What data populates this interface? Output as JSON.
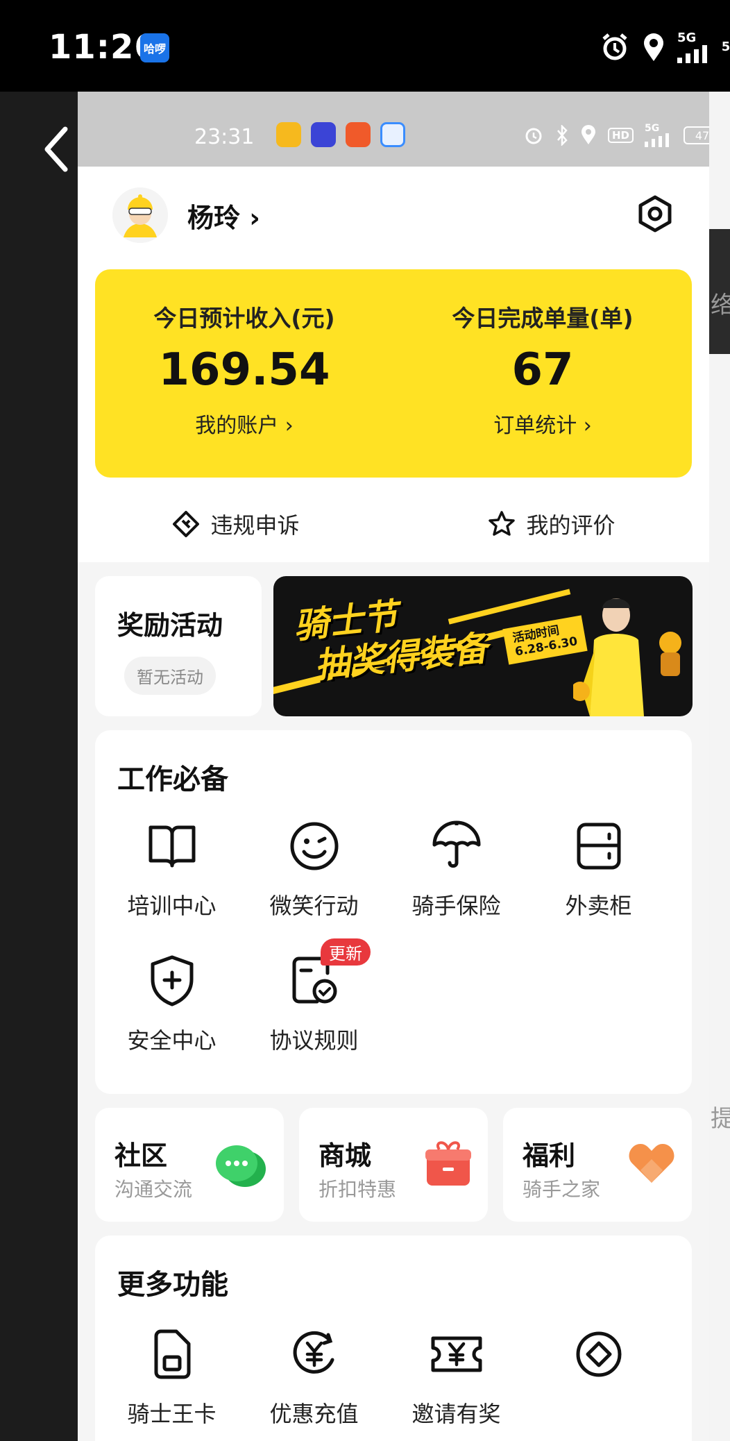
{
  "outer_status": {
    "time": "11:26",
    "app_badge": "哈啰",
    "network": "5G",
    "battery_partial": "5"
  },
  "inner_status": {
    "time": "23:31",
    "network": "5G",
    "hd": "HD",
    "battery": "47"
  },
  "profile": {
    "name": "杨玲 ›"
  },
  "earnings": {
    "income_label": "今日预计收入(元)",
    "income_value": "169.54",
    "account_link": "我的账户 ›",
    "orders_label": "今日完成单量(单)",
    "orders_value": "67",
    "orders_link": "订单统计 ›"
  },
  "quick": {
    "appeal": "违规申诉",
    "review": "我的评价"
  },
  "rewards": {
    "title": "奖励活动",
    "status": "暂无活动"
  },
  "banner": {
    "title_line1": "骑士节",
    "title_line2": "抽奖得装备",
    "date_label": "活动时间",
    "date_range": "6.28-6.30"
  },
  "work": {
    "title": "工作必备",
    "items": [
      {
        "label": "培训中心",
        "icon": "book-icon"
      },
      {
        "label": "微笑行动",
        "icon": "smile-icon"
      },
      {
        "label": "骑手保险",
        "icon": "umbrella-icon"
      },
      {
        "label": "外卖柜",
        "icon": "locker-icon"
      },
      {
        "label": "安全中心",
        "icon": "shield-plus-icon"
      },
      {
        "label": "协议规则",
        "icon": "agreement-icon",
        "badge": "更新"
      }
    ]
  },
  "mini_cards": [
    {
      "title": "社区",
      "subtitle": "沟通交流",
      "icon": "chat-bubble-icon"
    },
    {
      "title": "商城",
      "subtitle": "折扣特惠",
      "icon": "gift-icon"
    },
    {
      "title": "福利",
      "subtitle": "骑手之家",
      "icon": "heart-icon"
    }
  ],
  "more": {
    "title": "更多功能",
    "items": [
      {
        "label": "骑士王卡",
        "icon": "sim-card-icon"
      },
      {
        "label": "优惠充值",
        "icon": "yuan-recharge-icon"
      },
      {
        "label": "邀请有奖",
        "icon": "yuan-ticket-icon"
      },
      {
        "label": "",
        "icon": "coin-icon"
      }
    ]
  },
  "side": {
    "right_char_1": "络",
    "right_char_2": "提"
  },
  "colors": {
    "accent_yellow": "#ffe224",
    "badge_red": "#e8383d",
    "chat_green": "#2fc95a",
    "gift_red": "#f0564a",
    "heart_orange": "#f5914a"
  }
}
